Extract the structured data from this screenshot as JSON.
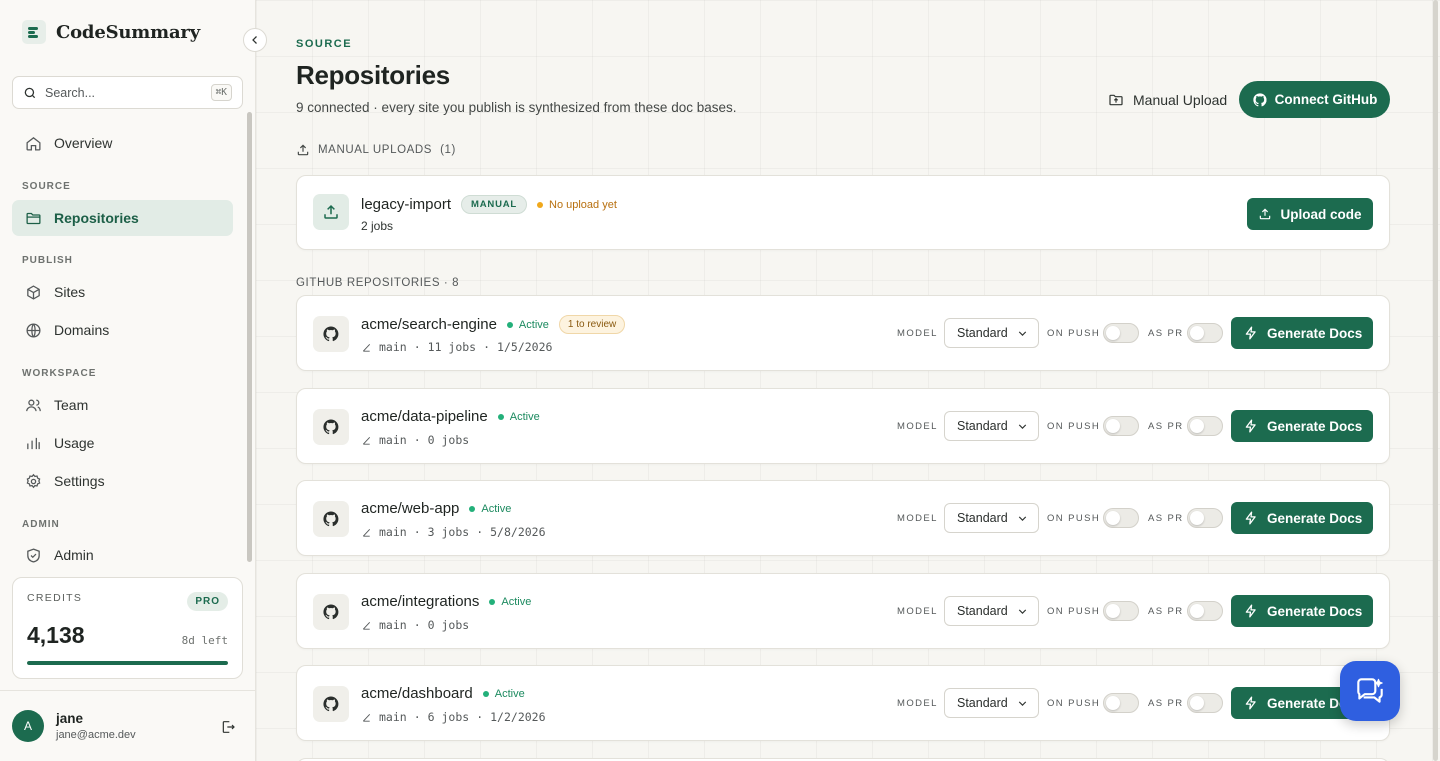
{
  "brand": {
    "name": "CodeSummary"
  },
  "search": {
    "placeholder": "Search...",
    "shortcut": "⌘K"
  },
  "nav": {
    "overview": "Overview",
    "source_label": "SOURCE",
    "repositories": "Repositories",
    "publish_label": "PUBLISH",
    "sites": "Sites",
    "domains": "Domains",
    "workspace_label": "WORKSPACE",
    "team": "Team",
    "usage": "Usage",
    "settings": "Settings",
    "admin_label": "ADMIN",
    "admin": "Admin"
  },
  "credits": {
    "label": "CREDITS",
    "plan": "PRO",
    "value": "4,138",
    "time_left": "8d left",
    "progress": 1.0
  },
  "user": {
    "initial": "A",
    "name": "jane",
    "email": "jane@acme.dev"
  },
  "header": {
    "eyebrow": "SOURCE",
    "title": "Repositories",
    "subtitle": "9 connected · every site you publish is synthesized from these doc bases.",
    "manual_upload": "Manual Upload",
    "connect_github": "Connect GitHub"
  },
  "manual_section": {
    "label": "MANUAL UPLOADS",
    "count": "(1)"
  },
  "manual_repo": {
    "name": "legacy-import",
    "badge": "MANUAL",
    "status": "No upload yet",
    "jobs": "2 jobs",
    "upload_label": "Upload code"
  },
  "github_section": {
    "label": "GITHUB REPOSITORIES · 8"
  },
  "labels": {
    "model": "MODEL",
    "on_push": "ON PUSH",
    "as_pr": "AS PR",
    "generate": "Generate Docs",
    "sep": "·"
  },
  "repos": [
    {
      "name": "acme/search-engine",
      "status": "Active",
      "review": "1 to review",
      "branch": "main",
      "jobs": "11 jobs",
      "date": "1/5/2026",
      "model": "Standard"
    },
    {
      "name": "acme/data-pipeline",
      "status": "Active",
      "branch": "main",
      "jobs": "0 jobs",
      "model": "Standard"
    },
    {
      "name": "acme/web-app",
      "status": "Active",
      "branch": "main",
      "jobs": "3 jobs",
      "date": "5/8/2026",
      "model": "Standard"
    },
    {
      "name": "acme/integrations",
      "status": "Active",
      "branch": "main",
      "jobs": "0 jobs",
      "model": "Standard"
    },
    {
      "name": "acme/dashboard",
      "status": "Active",
      "branch": "main",
      "jobs": "6 jobs",
      "date": "1/2/2026",
      "model": "Standard"
    }
  ],
  "colors": {
    "accent": "#1c6b4f",
    "active": "#23b07a",
    "warning": "#f0a81c",
    "chat": "#2f5fe0"
  }
}
